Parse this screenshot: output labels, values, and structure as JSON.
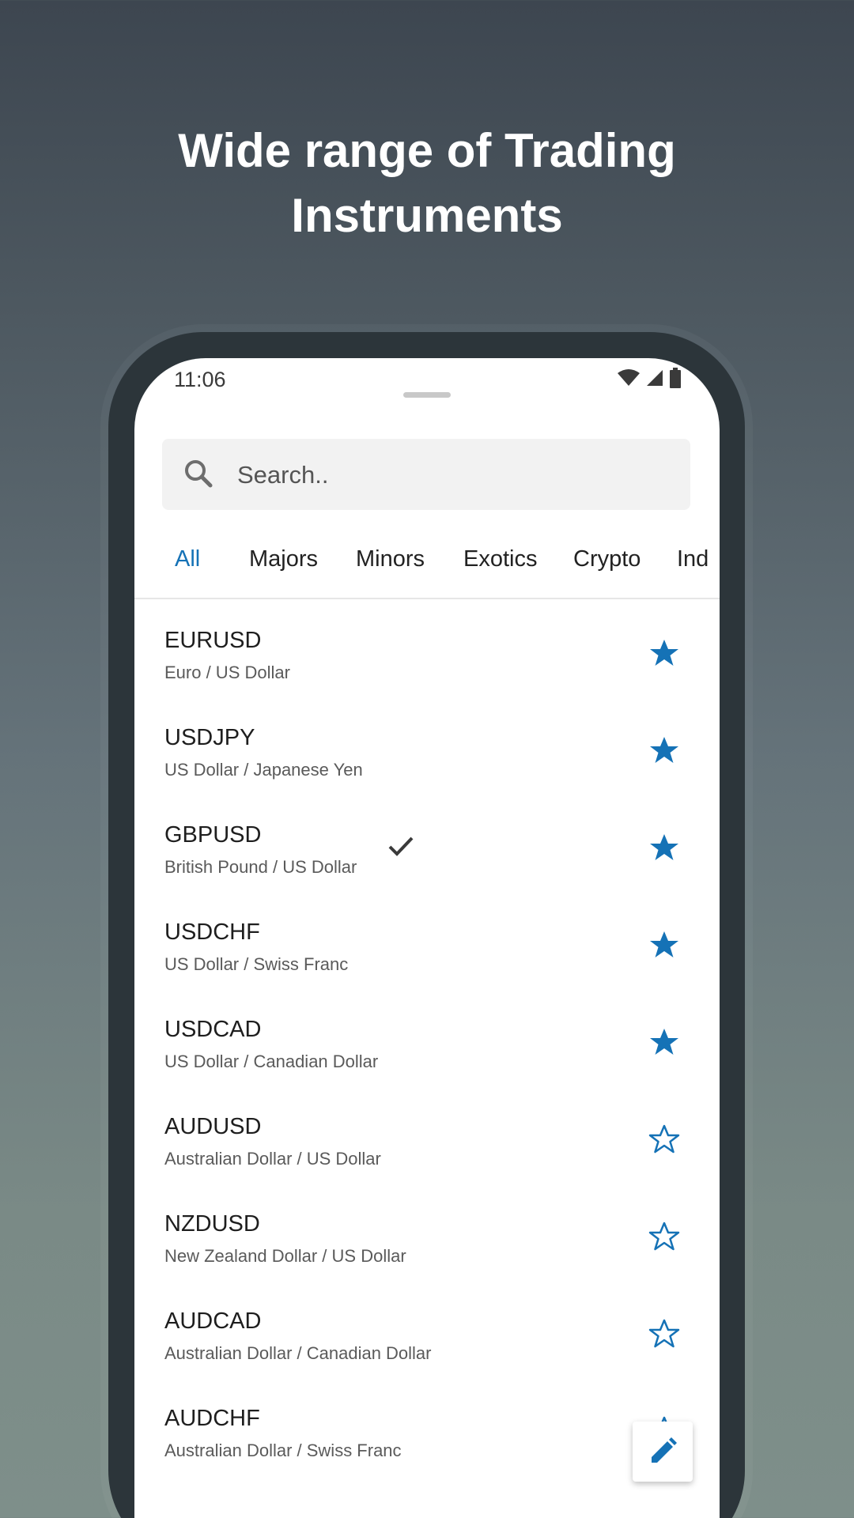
{
  "headline": {
    "line1": "Wide range of Trading",
    "line2": "Instruments"
  },
  "status_bar": {
    "time": "11:06",
    "icons": [
      "wifi-icon",
      "signal-icon",
      "battery-icon"
    ]
  },
  "search": {
    "placeholder": "Search.."
  },
  "tabs": [
    {
      "label": "All",
      "active": true
    },
    {
      "label": "Majors",
      "active": false
    },
    {
      "label": "Minors",
      "active": false
    },
    {
      "label": "Exotics",
      "active": false
    },
    {
      "label": "Crypto",
      "active": false
    },
    {
      "label": "Ind",
      "active": false
    }
  ],
  "instruments": [
    {
      "symbol": "EURUSD",
      "name": "Euro / US Dollar",
      "favorite": true,
      "checked": false
    },
    {
      "symbol": "USDJPY",
      "name": "US Dollar / Japanese Yen",
      "favorite": true,
      "checked": false
    },
    {
      "symbol": "GBPUSD",
      "name": "British Pound / US Dollar",
      "favorite": true,
      "checked": true
    },
    {
      "symbol": "USDCHF",
      "name": "US Dollar / Swiss Franc",
      "favorite": true,
      "checked": false
    },
    {
      "symbol": "USDCAD",
      "name": "US Dollar / Canadian Dollar",
      "favorite": true,
      "checked": false
    },
    {
      "symbol": "AUDUSD",
      "name": "Australian Dollar / US Dollar",
      "favorite": false,
      "checked": false
    },
    {
      "symbol": "NZDUSD",
      "name": "New Zealand Dollar / US Dollar",
      "favorite": false,
      "checked": false
    },
    {
      "symbol": "AUDCAD",
      "name": "Australian Dollar / Canadian Dollar",
      "favorite": false,
      "checked": false
    },
    {
      "symbol": "AUDCHF",
      "name": "Australian Dollar / Swiss Franc",
      "favorite": false,
      "checked": false
    }
  ],
  "fab": {
    "icon": "pencil-icon"
  },
  "colors": {
    "accent": "#1572b6",
    "text": "#1e1e1e",
    "subtext": "#5a5a5a"
  }
}
